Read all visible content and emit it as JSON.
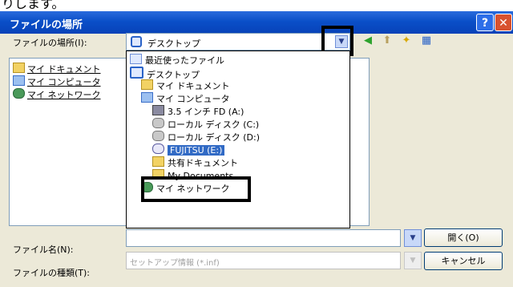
{
  "crop_text": "りします。",
  "window": {
    "title": "ファイルの場所",
    "help_label": "?",
    "close_label": "✕"
  },
  "look_in": {
    "label": "ファイルの場所(I):",
    "value": "デスクトップ"
  },
  "places": [
    {
      "label": "マイ ドキュメント",
      "icon": "folder-icon"
    },
    {
      "label": "マイ コンピュータ",
      "icon": "computer-icon"
    },
    {
      "label": "マイ ネットワーク",
      "icon": "network-icon"
    }
  ],
  "dropdown": [
    {
      "label": "最近使ったファイル",
      "icon": "recent-files-icon"
    },
    {
      "label": "デスクトップ",
      "icon": "desktop-icon"
    },
    {
      "label": "マイ ドキュメント",
      "icon": "folder-icon"
    },
    {
      "label": "マイ コンピュータ",
      "icon": "computer-icon"
    },
    {
      "label": "3.5 インチ FD (A:)",
      "icon": "floppy-icon"
    },
    {
      "label": "ローカル ディスク (C:)",
      "icon": "drive-icon"
    },
    {
      "label": "ローカル ディスク (D:)",
      "icon": "drive-icon"
    },
    {
      "label": "FUJITSU (E:)",
      "icon": "cd-drive-icon",
      "selected": true
    },
    {
      "label": "共有ドキュメント",
      "icon": "folder-icon"
    },
    {
      "label": "My Documents",
      "icon": "folder-icon"
    },
    {
      "label": "マイ ネットワーク",
      "icon": "network-icon"
    }
  ],
  "filename": {
    "label": "ファイル名(N):",
    "value": ""
  },
  "filetype": {
    "label": "ファイルの種類(T):",
    "value": "セットアップ情報 (*.inf)"
  },
  "buttons": {
    "open": "開く(O)",
    "cancel": "キャンセル"
  },
  "colors": {
    "title_blue": "#0a4fc8",
    "selection": "#316ac5",
    "highlight": "#000000"
  }
}
